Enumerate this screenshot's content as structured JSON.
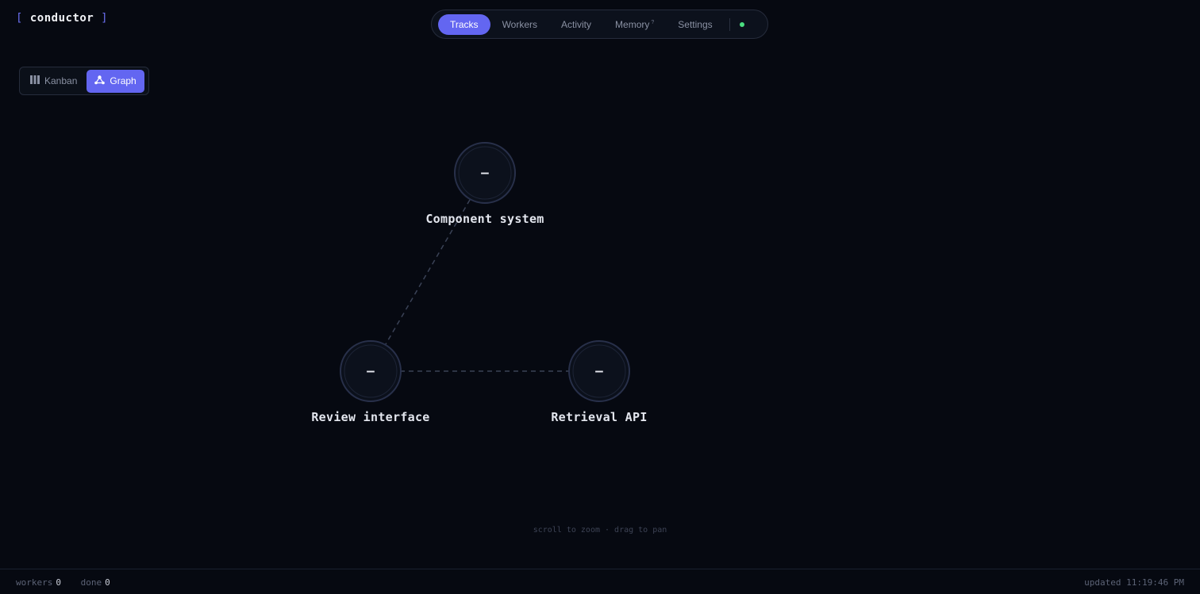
{
  "brand": {
    "open_bracket": "[",
    "name": "conductor",
    "close_bracket": "]"
  },
  "nav": {
    "tabs": [
      {
        "label": "Tracks",
        "active": true
      },
      {
        "label": "Workers",
        "active": false
      },
      {
        "label": "Activity",
        "active": false
      },
      {
        "label": "Memory",
        "badge": "?",
        "active": false
      },
      {
        "label": "Settings",
        "active": false
      }
    ],
    "status_color": "#4ade80"
  },
  "view_toggle": {
    "kanban_label": "Kanban",
    "graph_label": "Graph",
    "active": "Graph"
  },
  "graph": {
    "nodes": [
      {
        "label": "Component system",
        "symbol": "–"
      },
      {
        "label": "Review interface",
        "symbol": "–"
      },
      {
        "label": "Retrieval API",
        "symbol": "–"
      }
    ],
    "edges": [
      {
        "from": "Component system",
        "to": "Review interface"
      },
      {
        "from": "Review interface",
        "to": "Retrieval API"
      }
    ],
    "hint": "scroll to zoom · drag to pan"
  },
  "footer": {
    "workers_label": "workers",
    "workers_value": "0",
    "done_label": "done",
    "done_value": "0",
    "updated": "updated 11:19:46 PM"
  },
  "colors": {
    "accent": "#6366f1",
    "background": "#060911",
    "node_ring": "#2a3247"
  }
}
